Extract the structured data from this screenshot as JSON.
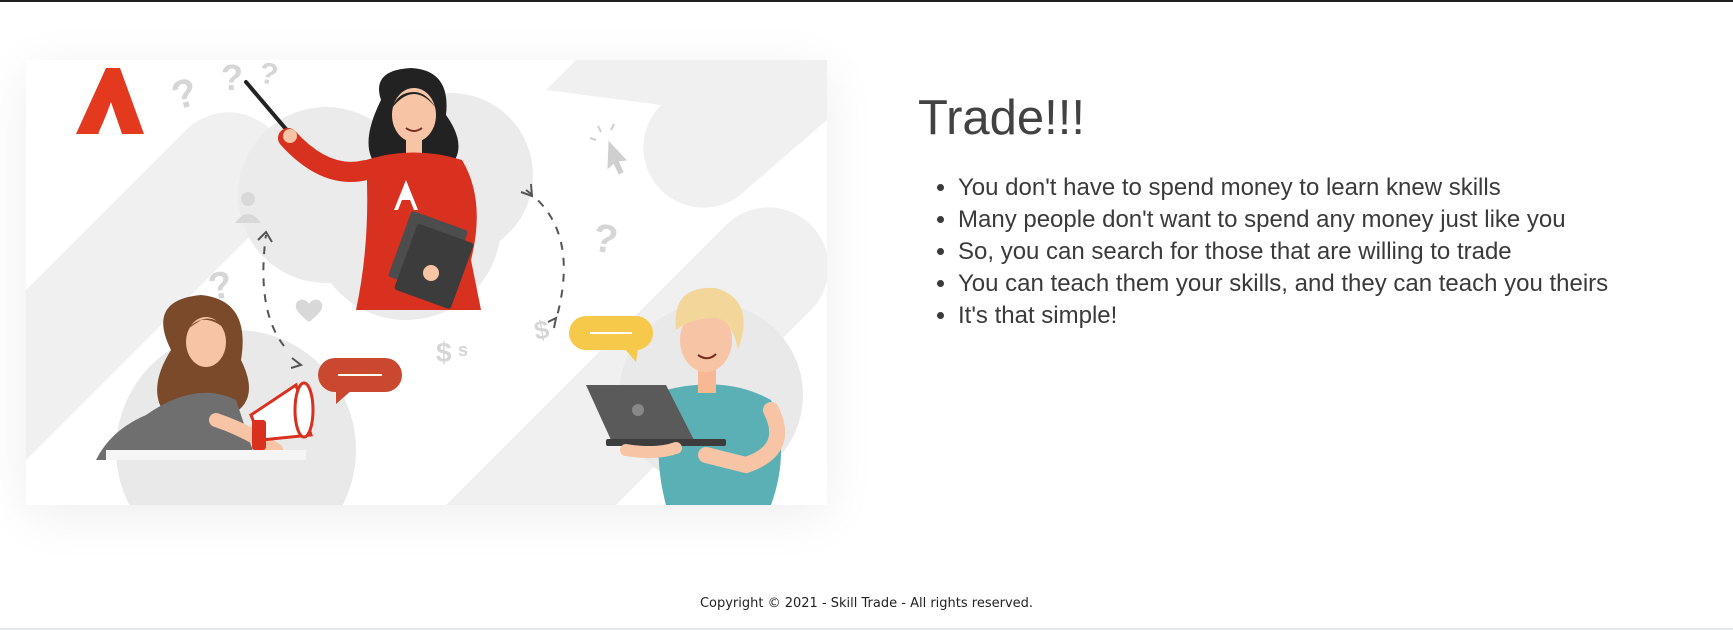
{
  "hero": {
    "title": "Trade!!!",
    "points": [
      "You don't have to spend money to learn knew skills",
      "Many people don't want to spend any money just like you",
      "So, you can search for those that are willing to trade",
      "You can teach them your skills, and they can teach you theirs",
      "It's that simple!"
    ]
  },
  "illustration": {
    "logo_letter": "A",
    "icons": [
      "brand-logo-icon",
      "question-mark-icon",
      "click-cursor-icon",
      "user-icon",
      "heart-icon",
      "dollar-icon",
      "chat-bubble-icon",
      "megaphone-icon",
      "laptop-icon"
    ]
  },
  "footer": {
    "copyright": "Copyright © 2021 - Skill Trade - All rights reserved."
  },
  "colors": {
    "accent_red": "#e2391f",
    "accent_yellow": "#f6c94a",
    "accent_teal": "#5bb0b6",
    "heading_text": "#424242",
    "body_text": "#3a3a3a"
  }
}
